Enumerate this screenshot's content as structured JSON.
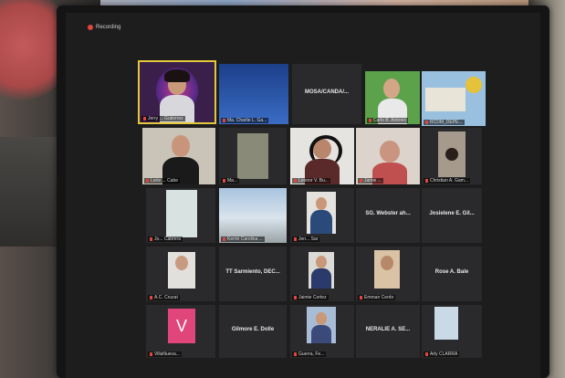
{
  "recording": {
    "label": "Recording"
  },
  "tiles": [
    {
      "id": "t1",
      "name": "Jerry ... Gutierrez"
    },
    {
      "id": "t2",
      "name": "Ma. Charlie L. Ga..."
    },
    {
      "id": "t3",
      "name": "",
      "center": "MOSA/CANDA/..."
    },
    {
      "id": "t4",
      "name": "Carlo B. Antonio"
    },
    {
      "id": "t5",
      "name": "RCDM_DEPE..."
    },
    {
      "id": "t6",
      "name": "Lorie ... Cabe"
    },
    {
      "id": "t7",
      "name": "Ma..."
    },
    {
      "id": "t8",
      "name": "Leonor V. Bu..."
    },
    {
      "id": "t9",
      "name": "Jamie ..."
    },
    {
      "id": "t10",
      "name": "Christian A. Gam..."
    },
    {
      "id": "t11",
      "name": "Jo... Cabrera"
    },
    {
      "id": "t12",
      "name": "Kerrin Carolina ..."
    },
    {
      "id": "t13",
      "name": "Jen... Sar"
    },
    {
      "id": "t14",
      "name": "",
      "center": "SG. Webster ah..."
    },
    {
      "id": "t15",
      "name": "",
      "center": "Josielene E. Gil..."
    },
    {
      "id": "t16",
      "name": "A.C. Cruzat"
    },
    {
      "id": "t17",
      "name": "",
      "center": "TT Sarmiento, DEC..."
    },
    {
      "id": "t18",
      "name": "Jaimie Cortez"
    },
    {
      "id": "t19",
      "name": "Emman Cerdo"
    },
    {
      "id": "t20",
      "name": "",
      "center": "Rose A. Bale"
    },
    {
      "id": "t21",
      "name": "VillaNueva..."
    },
    {
      "id": "t22",
      "name": "",
      "center": "Gilmore E. Dolle"
    },
    {
      "id": "t23",
      "name": "Guerra, Fe..."
    },
    {
      "id": "t24",
      "name": "",
      "center": "NERALIE A. SE..."
    },
    {
      "id": "t25",
      "name": "Arly CLARRA"
    }
  ],
  "colors": {
    "active_border": "#e2c83a",
    "tile_bg": "#2a2a2c",
    "mic_muted": "#e0463c",
    "v_tile": "#e0467a"
  }
}
